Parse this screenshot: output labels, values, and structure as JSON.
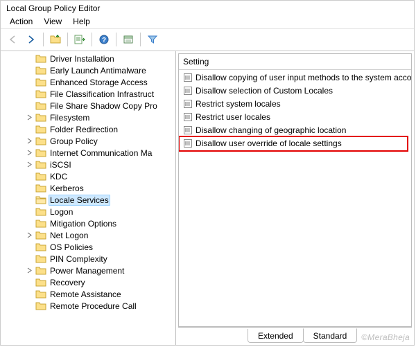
{
  "window": {
    "title": "Local Group Policy Editor"
  },
  "menu": {
    "items": [
      "Action",
      "View",
      "Help"
    ]
  },
  "tree": {
    "items": [
      {
        "label": "Driver Installation",
        "expandable": false
      },
      {
        "label": "Early Launch Antimalware",
        "expandable": false
      },
      {
        "label": "Enhanced Storage Access",
        "expandable": false
      },
      {
        "label": "File Classification Infrastruct",
        "expandable": false
      },
      {
        "label": "File Share Shadow Copy Pro",
        "expandable": false
      },
      {
        "label": "Filesystem",
        "expandable": true
      },
      {
        "label": "Folder Redirection",
        "expandable": false
      },
      {
        "label": "Group Policy",
        "expandable": true
      },
      {
        "label": "Internet Communication Ma",
        "expandable": true
      },
      {
        "label": "iSCSI",
        "expandable": true
      },
      {
        "label": "KDC",
        "expandable": false
      },
      {
        "label": "Kerberos",
        "expandable": false
      },
      {
        "label": "Locale Services",
        "expandable": false,
        "selected": true
      },
      {
        "label": "Logon",
        "expandable": false
      },
      {
        "label": "Mitigation Options",
        "expandable": false
      },
      {
        "label": "Net Logon",
        "expandable": true
      },
      {
        "label": "OS Policies",
        "expandable": false
      },
      {
        "label": "PIN Complexity",
        "expandable": false
      },
      {
        "label": "Power Management",
        "expandable": true
      },
      {
        "label": "Recovery",
        "expandable": false
      },
      {
        "label": "Remote Assistance",
        "expandable": false
      },
      {
        "label": "Remote Procedure Call",
        "expandable": false
      }
    ]
  },
  "list": {
    "header": "Setting",
    "items": [
      "Disallow copying of user input methods to the system acco...",
      "Disallow selection of Custom Locales",
      "Restrict system locales",
      "Restrict user locales",
      "Disallow changing of geographic location",
      "Disallow user override of locale settings"
    ],
    "highlighted_index": 5
  },
  "tabs": {
    "items": [
      "Extended",
      "Standard"
    ],
    "active_index": 1
  },
  "watermark": "©MeraBheja"
}
